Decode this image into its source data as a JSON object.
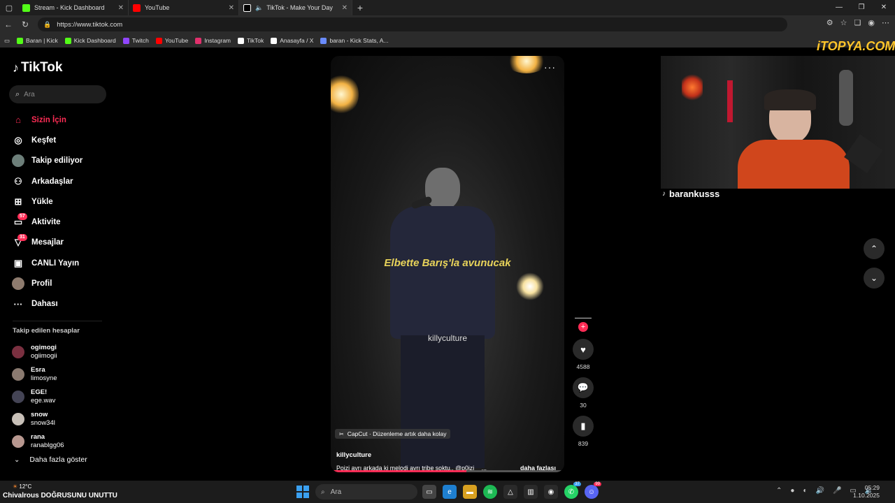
{
  "browser": {
    "tabs": [
      {
        "label": "Stream - Kick Dashboard",
        "color": "#53fc18"
      },
      {
        "label": "YouTube",
        "color": "#ff0000"
      },
      {
        "label": "TikTok - Make Your Day",
        "color": "#ffffff"
      }
    ],
    "url": "https://www.tiktok.com",
    "bookmarks": [
      {
        "label": "Baran | Kick",
        "color": "#53fc18"
      },
      {
        "label": "Kick Dashboard",
        "color": "#53fc18"
      },
      {
        "label": "Twitch",
        "color": "#9146ff"
      },
      {
        "label": "YouTube",
        "color": "#ff0000"
      },
      {
        "label": "Instagram",
        "color": "#e1306c"
      },
      {
        "label": "TikTok",
        "color": "#ffffff"
      },
      {
        "label": "Anasayfa / X",
        "color": "#ffffff"
      },
      {
        "label": "baran - Kick Stats, A...",
        "color": "#6a8cff"
      }
    ]
  },
  "tiktok": {
    "logo": "TikTok",
    "search_placeholder": "Ara",
    "nav": [
      {
        "label": "Sizin İçin",
        "icon": "home-icon",
        "glyph": "⌂"
      },
      {
        "label": "Keşfet",
        "icon": "compass-icon",
        "glyph": "◎"
      },
      {
        "label": "Takip ediliyor",
        "icon": "avatar-icon",
        "glyph": ""
      },
      {
        "label": "Arkadaşlar",
        "icon": "friends-icon",
        "glyph": "⚇"
      },
      {
        "label": "Yükle",
        "icon": "upload-icon",
        "glyph": "⊞"
      },
      {
        "label": "Aktivite",
        "icon": "activity-icon",
        "glyph": "▭",
        "badge": "57"
      },
      {
        "label": "Mesajlar",
        "icon": "messages-icon",
        "glyph": "▽",
        "badge": "31"
      },
      {
        "label": "CANLI Yayın",
        "icon": "live-icon",
        "glyph": "▣"
      },
      {
        "label": "Profil",
        "icon": "profile-avatar-icon",
        "glyph": ""
      },
      {
        "label": "Dahası",
        "icon": "more-icon",
        "glyph": "···"
      }
    ],
    "following_title": "Takip edilen hesaplar",
    "following": [
      {
        "name": "ogimogi",
        "handle": "ogiimogii",
        "color": "#7a3040"
      },
      {
        "name": "Esra",
        "handle": "limosyne",
        "color": "#8a7a70"
      },
      {
        "name": "EGE!",
        "handle": "ege.wav",
        "color": "#444455"
      },
      {
        "name": "snow",
        "handle": "snow34l",
        "color": "#c8c0b8"
      },
      {
        "name": "rana",
        "handle": "ranablgg06",
        "color": "#b89890"
      }
    ],
    "show_more": "Daha fazla göster"
  },
  "video": {
    "caption": "Elbette Barış'la avunucak",
    "watermark": "killyculture",
    "capcut": "CapCut · Düzenleme artık daha kolay",
    "author": "killyculture",
    "description": "Poizi ayrı arkada ki melodi ayrı tribe soktu..  @p0izi",
    "ellipsis": "...",
    "more": "daha fazlası",
    "progress": 0.58,
    "likes": "4588",
    "comments": "30",
    "saves": "839"
  },
  "stream": {
    "streamer": "barankusss",
    "site_logo": "iTOPYA.COM"
  },
  "taskbar": {
    "temp": "12°C",
    "ticker": "Chivalrous DOĞRUSUNU UNUTTU",
    "search": "Ara",
    "time": "05:29",
    "date": "1.10.2025",
    "badge_whatsapp": "37",
    "badge_discord": "99"
  }
}
